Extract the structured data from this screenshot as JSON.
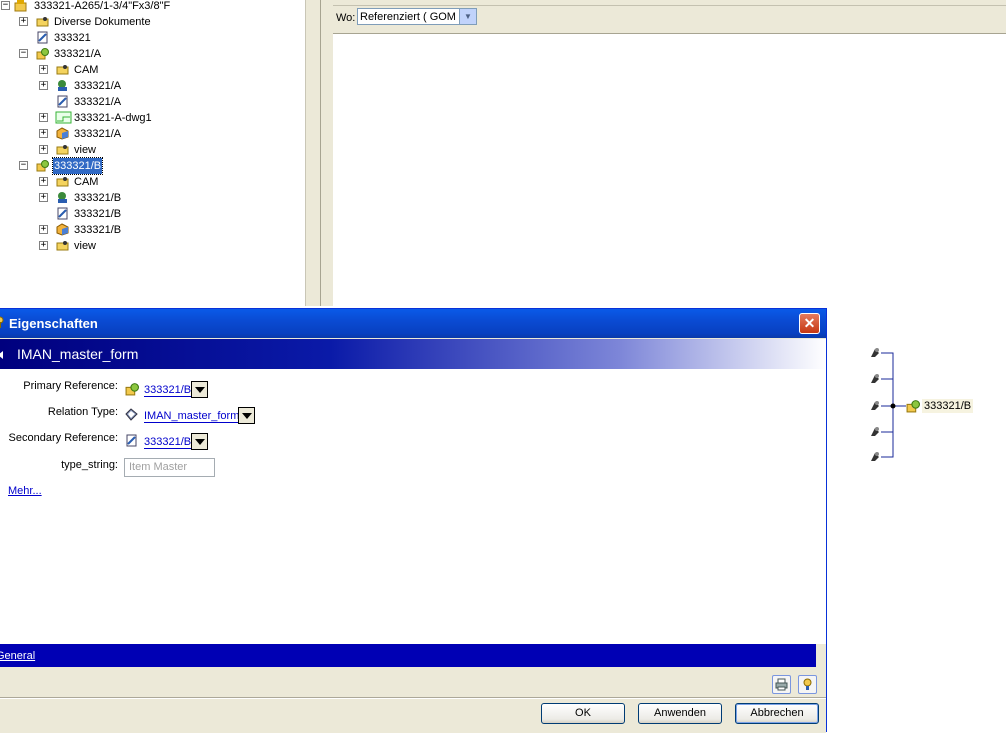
{
  "tree": {
    "items": [
      {
        "label": "333321-A265/1-3/4\"Fx3/8\"F",
        "expander": "−"
      },
      {
        "label": "Diverse Dokumente",
        "expander": "+"
      },
      {
        "label": "333321",
        "expander": ""
      },
      {
        "label": "333321/A",
        "expander": "−"
      },
      {
        "label": "CAM",
        "expander": "+"
      },
      {
        "label": "333321/A",
        "expander": "+"
      },
      {
        "label": "333321/A",
        "expander": ""
      },
      {
        "label": "333321-A-dwg1",
        "expander": "+"
      },
      {
        "label": "333321/A",
        "expander": "+"
      },
      {
        "label": "view",
        "expander": "+"
      },
      {
        "label": "333321/B",
        "expander": "−"
      },
      {
        "label": "CAM",
        "expander": "+"
      },
      {
        "label": "333321/B",
        "expander": "+"
      },
      {
        "label": "333321/B",
        "expander": ""
      },
      {
        "label": "333321/B",
        "expander": "+"
      },
      {
        "label": "view",
        "expander": "+"
      }
    ]
  },
  "referencer": {
    "wo_label": "Wo:",
    "wo_value": "Referenziert ( GOM )"
  },
  "graph": {
    "center_label": "333321/B"
  },
  "dialog": {
    "title": "Eigenschaften",
    "close_glyph": "✕",
    "header": "IMAN_master_form",
    "properties": {
      "primary_reference_label": "Primary Reference:",
      "primary_reference_value": "333321/B",
      "relation_type_label": "Relation Type:",
      "relation_type_value": "IMAN_master_form",
      "secondary_reference_label": "Secondary Reference:",
      "secondary_reference_value": "333321/B",
      "type_string_label": "type_string:",
      "type_string_value": "Item Master"
    },
    "more_link": "Mehr...",
    "section_label": "General",
    "buttons": {
      "ok": "OK",
      "apply": "Anwenden",
      "cancel": "Abbrechen"
    }
  },
  "colors": {
    "selection": "#316ac5",
    "titlebar": "#0a4bd3",
    "header_dark": "#00007e",
    "section_bar": "#0000b4",
    "link": "#0000cc"
  }
}
